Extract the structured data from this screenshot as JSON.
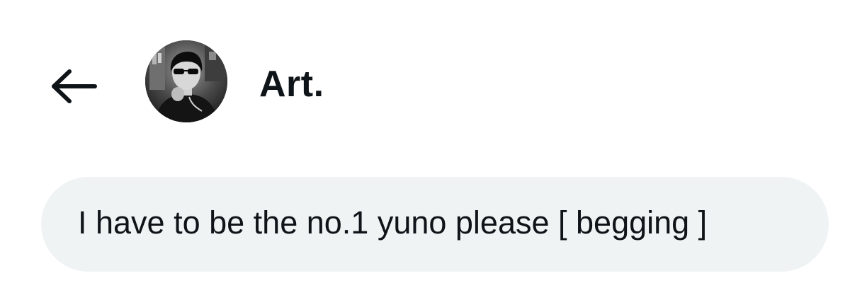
{
  "header": {
    "back_icon": "arrow-left-icon",
    "avatar_icon": "user-avatar-photo",
    "display_name": "Art."
  },
  "conversation": {
    "messages": [
      {
        "text": "I have to be the no.1 yuno please [ begging ]"
      }
    ]
  },
  "colors": {
    "text": "#0f1419",
    "bubble_background": "#eff3f4",
    "background": "#ffffff"
  }
}
